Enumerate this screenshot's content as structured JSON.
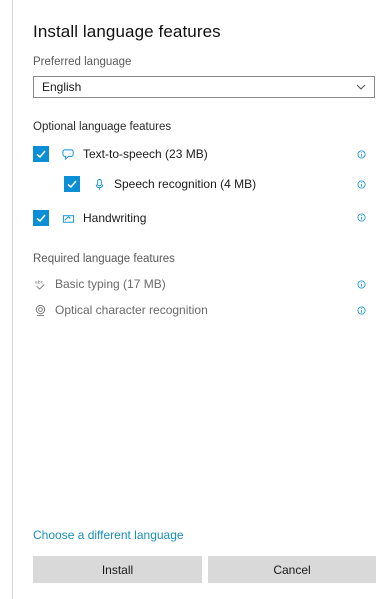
{
  "dialog": {
    "title": "Install language features",
    "preferred_label": "Preferred language",
    "language_select": {
      "value": "English"
    },
    "optional_label": "Optional language features",
    "optional_features": [
      {
        "label": "Text-to-speech (23 MB)",
        "checked": true,
        "icon": "speech-bubble-icon"
      },
      {
        "label": "Speech recognition (4 MB)",
        "checked": true,
        "icon": "microphone-icon"
      },
      {
        "label": "Handwriting",
        "checked": true,
        "icon": "handwriting-icon"
      }
    ],
    "required_label": "Required language features",
    "required_features": [
      {
        "label": "Basic typing (17 MB)",
        "icon": "spellcheck-icon"
      },
      {
        "label": "Optical character recognition",
        "icon": "ocr-icon"
      }
    ],
    "choose_link": "Choose a different language",
    "install_label": "Install",
    "cancel_label": "Cancel"
  },
  "colors": {
    "accent": "#0a8fd6",
    "link": "#1a8fb9",
    "button_bg": "#d9d9d9"
  }
}
